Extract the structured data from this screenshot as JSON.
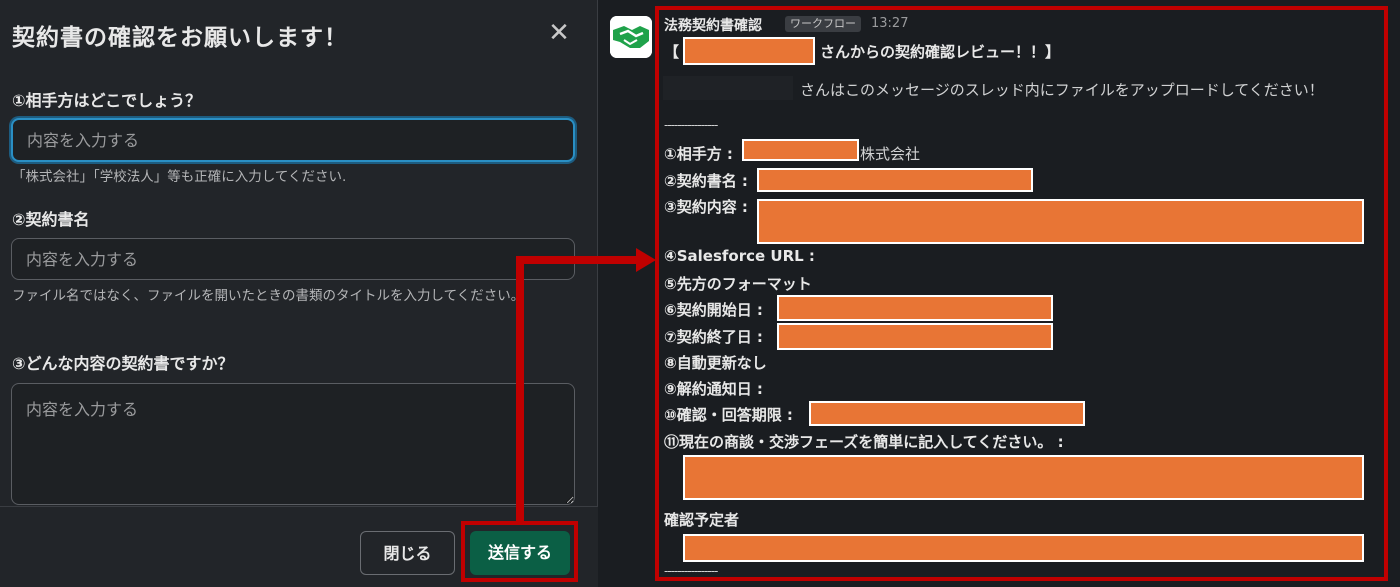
{
  "modal": {
    "title": "契約書の確認をお願いします！",
    "close_icon": "close-icon",
    "questions": [
      {
        "label": "①相手方はどこでしょう？",
        "placeholder": "内容を入力する",
        "hint": "「株式会社」「学校法人」等も正確に入力してください."
      },
      {
        "label": "②契約書名",
        "placeholder": "内容を入力する",
        "hint": "ファイル名ではなく、ファイルを開いたときの書類のタイトルを入力してください。"
      },
      {
        "label": "③どんな内容の契約書ですか？",
        "placeholder": "内容を入力する"
      }
    ],
    "buttons": {
      "close": "閉じる",
      "send": "送信する"
    }
  },
  "message": {
    "avatar_icon": "handshake-icon",
    "sender": "法務契約書確認",
    "badge": "ワークフロー",
    "time": "13:27",
    "title_open": "【",
    "title_rest": "さんからの契約確認レビュー！！】",
    "upload_note": "さんはこのメッセージのスレッド内にファイルをアップロードしてください！",
    "separator": "----------------",
    "fields": {
      "counterparty": "①相手方 :",
      "counterparty_suffix": "株式会社",
      "contract_name": "②契約書名 :",
      "contract_content": "③契約内容 :",
      "salesforce": "④Salesforce URL :",
      "format": "⑤先方のフォーマット",
      "start_date": "⑥契約開始日 :",
      "end_date": "⑦契約終了日 :",
      "auto_renew": "⑧自動更新なし",
      "cancel_notice": "⑨解約通知日 :",
      "deadline": "⑩確認・回答期限 :",
      "negotiation": "⑪現在の商談・交渉フェーズを簡単に記入してください。 :",
      "reviewer": "確認予定者"
    }
  },
  "colors": {
    "highlight": "#c00000",
    "redaction": "#e87535",
    "send_button": "#0b5f45",
    "focus": "#2a8fc4"
  }
}
